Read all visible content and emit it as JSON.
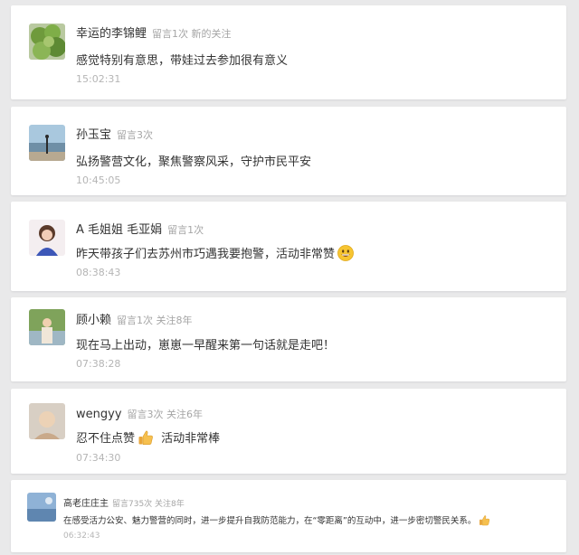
{
  "comments": [
    {
      "name": "幸运的李锦鲤",
      "tags": "留言1次 新的关注",
      "text": "感觉特别有意思，带娃过去参加很有意义",
      "time": "15:02:31"
    },
    {
      "name": "孙玉宝",
      "tags": "留言3次",
      "text": "弘扬警营文化，聚焦警察风采，守护市民平安",
      "time": "10:45:05"
    },
    {
      "name": "A 毛姐姐 毛亚娟",
      "tags": "留言1次",
      "text": "昨天带孩子们去苏州市巧遇我要抱警，活动非常赞",
      "time": "08:38:43"
    },
    {
      "name": "顾小赖",
      "tags": "留言1次 关注8年",
      "text": "现在马上出动，崽崽一早醒来第一句话就是走吧！",
      "time": "07:38:28"
    },
    {
      "name": "wengyy",
      "tags": "留言3次 关注6年",
      "text_a": "忍不住点赞",
      "text_b": "活动非常棒",
      "time": "07:34:30"
    },
    {
      "name": "高老庄庄主",
      "tags": "留言735次 关注8年",
      "text": "在感受活力公安、魅力警营的同时，进一步提升自我防范能力，在“零距离”的互动中，进一步密切警民关系。",
      "time": "06:32:43"
    }
  ],
  "icons": {
    "smile": "grinning-face-emoji",
    "thumbs": "thumbs-up-emoji"
  }
}
